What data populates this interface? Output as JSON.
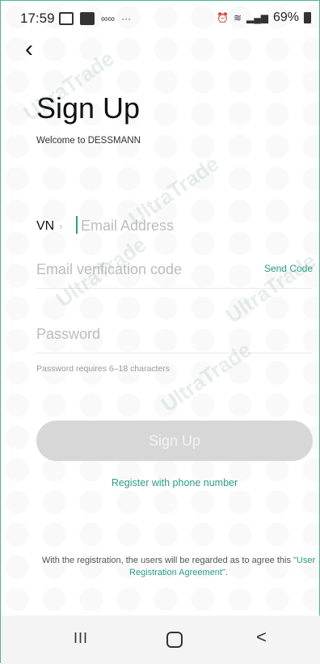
{
  "status_bar": {
    "time": "17:59",
    "extra": "∞∞",
    "dots": "···",
    "battery": "69%"
  },
  "header": {
    "back_icon": "‹",
    "title": "Sign Up",
    "subtitle": "Welcome to DESSMANN"
  },
  "form": {
    "country_code": "VN",
    "country_chevron": "›",
    "email_placeholder": "Email Address",
    "code_placeholder": "Email verification code",
    "send_code": "Send Code",
    "password_placeholder": "Password",
    "password_hint": "Password requires 6–18 characters",
    "submit_label": "Sign Up",
    "alt_register": "Register with phone number"
  },
  "agreement": {
    "text_before": "With the registration, the users will be regarded as to agree this ",
    "link": "\"User Registration Agreement\"",
    "text_after": "."
  },
  "watermark": "UltraTrade",
  "nav": {
    "recent": "III",
    "back": "<"
  },
  "colors": {
    "accent": "#2a9d84",
    "button_disabled": "#d7d7d7"
  }
}
